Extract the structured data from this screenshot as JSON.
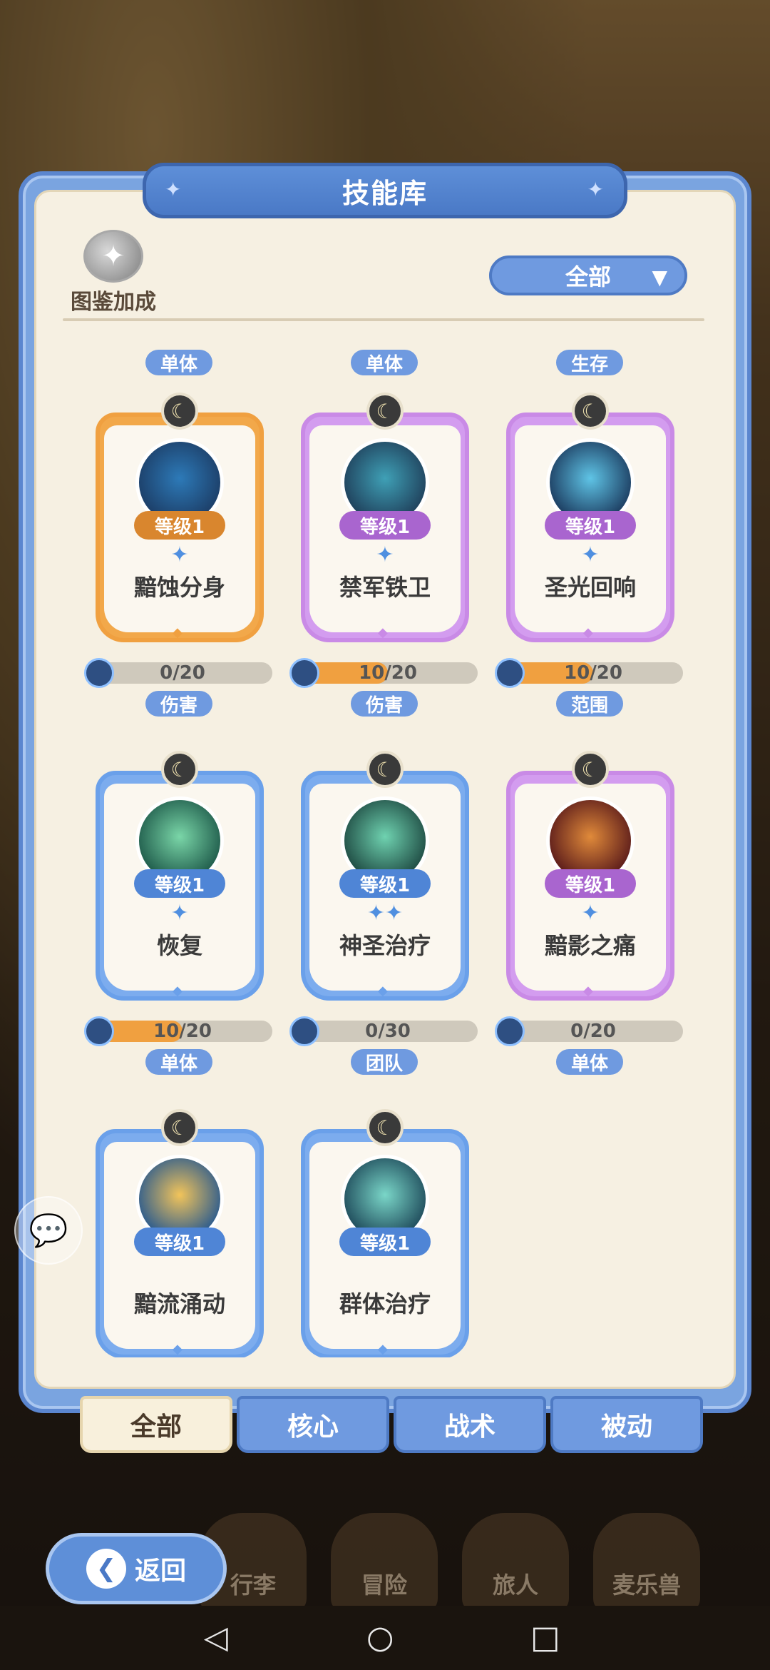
{
  "panel": {
    "title": "技能库",
    "codex_label": "图鉴加成",
    "filter": {
      "selected": "全部",
      "caret": "▼"
    }
  },
  "top_tags": [
    "单体",
    "单体",
    "生存"
  ],
  "skills": [
    {
      "name": "黯蚀分身",
      "level": "等级1",
      "stars": "✦",
      "progress": "0/20",
      "progress_fraction": 0.0,
      "tag": "伤害",
      "color": "orange",
      "orb": [
        "#1c3d66",
        "#2d7ab8"
      ]
    },
    {
      "name": "禁军铁卫",
      "level": "等级1",
      "stars": "✦",
      "progress": "10/20",
      "progress_fraction": 0.5,
      "tag": "伤害",
      "color": "purple",
      "orb": [
        "#1f3f5a",
        "#3fa0b6"
      ]
    },
    {
      "name": "圣光回响",
      "level": "等级1",
      "stars": "✦",
      "progress": "10/20",
      "progress_fraction": 0.5,
      "tag": "范围",
      "color": "purple",
      "orb": [
        "#1b3a5e",
        "#5fc4e6"
      ]
    },
    {
      "name": "恢复",
      "level": "等级1",
      "stars": "✦",
      "progress": "10/20",
      "progress_fraction": 0.5,
      "tag": "单体",
      "color": "blue",
      "orb": [
        "#1e5a4a",
        "#7ad6a8"
      ]
    },
    {
      "name": "神圣治疗",
      "level": "等级1",
      "stars": "✦✦",
      "progress": "0/30",
      "progress_fraction": 0.0,
      "tag": "团队",
      "color": "blue",
      "orb": [
        "#1e4a42",
        "#6fd2b0"
      ]
    },
    {
      "name": "黯影之痛",
      "level": "等级1",
      "stars": "✦",
      "progress": "0/20",
      "progress_fraction": 0.0,
      "tag": "单体",
      "color": "purple",
      "orb": [
        "#5a1a1a",
        "#e08a3a"
      ]
    },
    {
      "name": "黯流涌动",
      "level": "等级1",
      "stars": "",
      "progress": "",
      "progress_fraction": null,
      "tag": "",
      "color": "blue",
      "orb": [
        "#2a5a8e",
        "#f2c45a"
      ]
    },
    {
      "name": "群体治疗",
      "level": "等级1",
      "stars": "",
      "progress": "",
      "progress_fraction": null,
      "tag": "",
      "color": "blue",
      "orb": [
        "#1e4a5a",
        "#7ad6c8"
      ]
    }
  ],
  "tabs": [
    {
      "label": "全部",
      "active": true
    },
    {
      "label": "核心",
      "active": false
    },
    {
      "label": "战术",
      "active": false
    },
    {
      "label": "被动",
      "active": false
    }
  ],
  "bottom_nav": [
    "行李",
    "冒险",
    "旅人",
    "麦乐兽"
  ],
  "back_label": "返回",
  "system_nav": {
    "back": "◁",
    "home": "○",
    "recent": "□"
  }
}
